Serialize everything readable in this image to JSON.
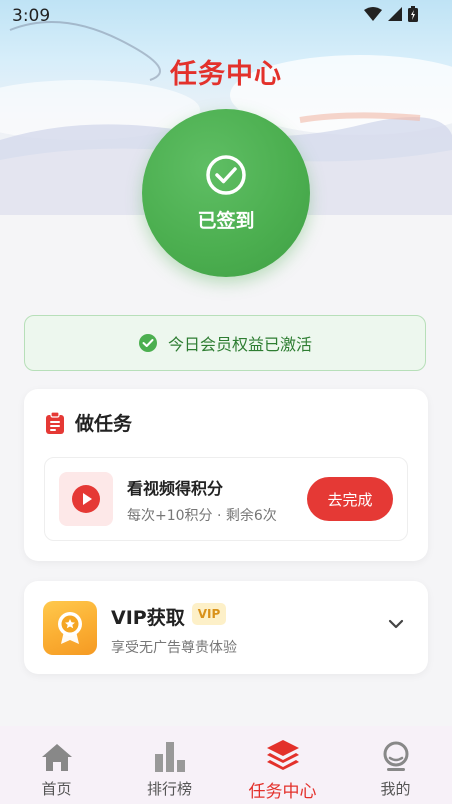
{
  "status_bar": {
    "time": "3:09"
  },
  "header": {
    "title": "任务中心"
  },
  "checkin": {
    "label": "已签到"
  },
  "banner": {
    "text": "今日会员权益已激活"
  },
  "tasks": {
    "title": "做任务",
    "items": [
      {
        "title": "看视频得积分",
        "desc": "每次+10积分 · 剩余6次",
        "button": "去完成"
      }
    ]
  },
  "vip": {
    "title": "VIP获取",
    "badge": "VIP",
    "desc": "享受无广告尊贵体验"
  },
  "tabs": [
    {
      "label": "首页",
      "icon": "home-icon"
    },
    {
      "label": "排行榜",
      "icon": "bar-chart-icon"
    },
    {
      "label": "任务中心",
      "icon": "layers-icon",
      "active": true
    },
    {
      "label": "我的",
      "icon": "profile-icon"
    }
  ],
  "colors": {
    "accent": "#e3312b",
    "success": "#4caf50",
    "vip": "#fbb034"
  }
}
